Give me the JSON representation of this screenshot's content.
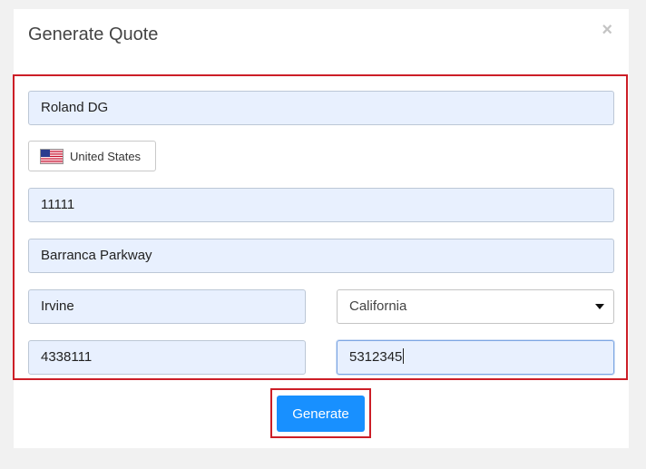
{
  "modal": {
    "title": "Generate Quote",
    "close_symbol": "×"
  },
  "form": {
    "company": "Roland DG",
    "country": {
      "label": "United States",
      "flag_icon": "us-flag-icon"
    },
    "postal_code": "11111",
    "street": "Barranca Parkway",
    "city": "Irvine",
    "state": "California",
    "phone": "4338111",
    "fax": "5312345"
  },
  "actions": {
    "generate_label": "Generate"
  },
  "colors": {
    "accent": "#1890ff",
    "highlight_border": "#cc1e27",
    "autofill_bg": "#e8f0fe"
  }
}
